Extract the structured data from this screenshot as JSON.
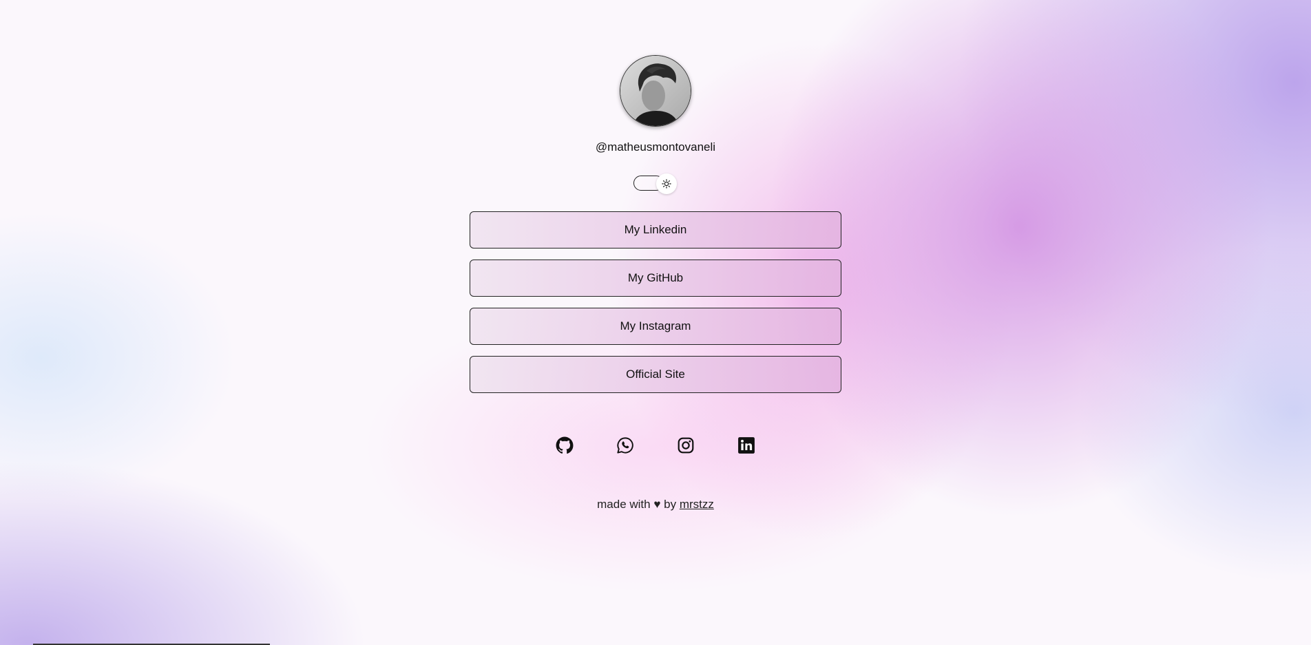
{
  "profile": {
    "avatar_icon": "profile-photo",
    "handle": "@matheusmontovaneli"
  },
  "theme_toggle": {
    "icon": "sun-icon",
    "state": "light"
  },
  "links": [
    {
      "label": "My Linkedin"
    },
    {
      "label": "My GitHub"
    },
    {
      "label": "My Instagram"
    },
    {
      "label": "Official Site"
    }
  ],
  "social": [
    {
      "icon": "github-icon"
    },
    {
      "icon": "whatsapp-icon"
    },
    {
      "icon": "instagram-icon"
    },
    {
      "icon": "linkedin-icon"
    }
  ],
  "footer": {
    "prefix": "made with ♥ by ",
    "author": "mrstzz"
  }
}
